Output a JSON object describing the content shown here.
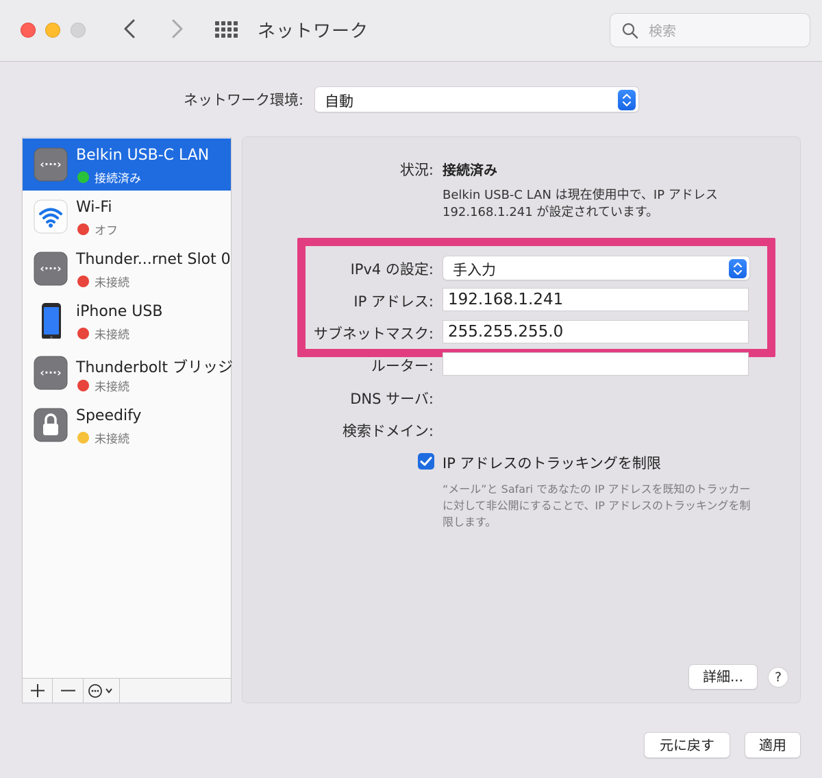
{
  "window": {
    "title": "ネットワーク",
    "search_placeholder": "検索"
  },
  "location": {
    "label": "ネットワーク環境:",
    "value": "自動"
  },
  "services": [
    {
      "name": "Belkin USB-C LAN",
      "status": "接続済み",
      "status_color": "#29c23b",
      "icon": "ethernet-icon",
      "selected": true
    },
    {
      "name": "Wi-Fi",
      "status": "オフ",
      "status_color": "#e8453c",
      "icon": "wifi-icon",
      "selected": false
    },
    {
      "name": "Thunder...rnet Slot 0",
      "status": "未接続",
      "status_color": "#e8453c",
      "icon": "ethernet-icon",
      "selected": false
    },
    {
      "name": "iPhone USB",
      "status": "未接続",
      "status_color": "#e8453c",
      "icon": "iphone-icon",
      "selected": false
    },
    {
      "name": "Thunderbolt ブリッジ",
      "status": "未接続",
      "status_color": "#e8453c",
      "icon": "ethernet-icon",
      "selected": false
    },
    {
      "name": "Speedify",
      "status": "未接続",
      "status_color": "#f6c13b",
      "icon": "lock-icon",
      "selected": false
    }
  ],
  "detail": {
    "status_label": "状況:",
    "status_value": "接続済み",
    "status_desc": "Belkin USB-C LAN は現在使用中で、IP アドレス 192.168.1.241 が設定されています。",
    "ipv4_label": "IPv4 の設定:",
    "ipv4_value": "手入力",
    "ip_label": "IP アドレス:",
    "ip_value": "192.168.1.241",
    "subnet_label": "サブネットマスク:",
    "subnet_value": "255.255.255.0",
    "router_label": "ルーター:",
    "router_value": "",
    "dns_label": "DNS サーバ:",
    "search_domain_label": "検索ドメイン:",
    "tracking_label": "IP アドレスのトラッキングを制限",
    "tracking_checked": true,
    "tracking_note": "“メール”と Safari であなたの IP アドレスを既知のトラッカーに対して非公開にすることで、IP アドレスのトラッキングを制限します。",
    "advanced_button": "詳細...",
    "help_button": "?"
  },
  "footer": {
    "revert_button": "元に戻す",
    "apply_button": "適用"
  },
  "colors": {
    "accent": "#1f6ce0",
    "highlight": "#e23d81"
  }
}
